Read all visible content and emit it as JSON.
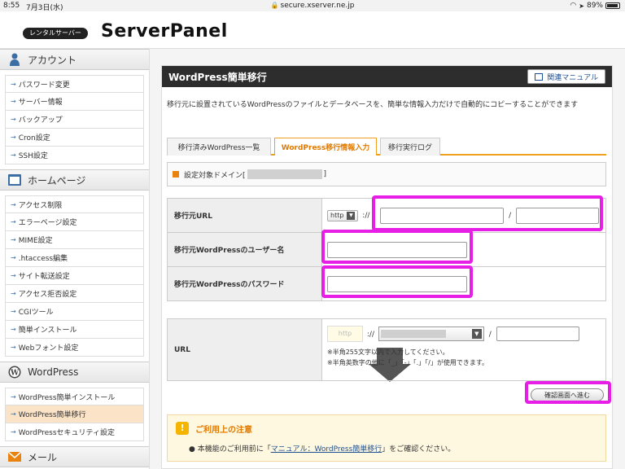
{
  "status_bar": {
    "time": "8:55",
    "date": "7月3日(水)",
    "url": "secure.xserver.ne.jp",
    "battery": "89%"
  },
  "header": {
    "badge": "レンタルサーバー",
    "title": "ServerPanel"
  },
  "sidebar": {
    "sections": [
      {
        "title": "アカウント",
        "icon": "person-icon",
        "items": [
          "パスワード変更",
          "サーバー情報",
          "バックアップ",
          "Cron設定",
          "SSH設定"
        ]
      },
      {
        "title": "ホームページ",
        "icon": "homepage-icon",
        "items": [
          "アクセス制限",
          "エラーページ設定",
          "MIME設定",
          ".htaccess編集",
          "サイト転送設定",
          "アクセス拒否設定",
          "CGIツール",
          "簡単インストール",
          "Webフォント設定"
        ]
      },
      {
        "title": "WordPress",
        "icon": "wordpress-icon",
        "items": [
          "WordPress簡単インストール",
          "WordPress簡単移行",
          "WordPressセキュリティ設定"
        ],
        "active_index": 1
      },
      {
        "title": "メール",
        "icon": "mail-icon",
        "items": []
      }
    ]
  },
  "main": {
    "title": "WordPress簡単移行",
    "manual_button": "関連マニュアル",
    "description": "移行元に設置されているWordPressのファイルとデータベースを、簡単な情報入力だけで自動的にコピーすることができます",
    "tabs": [
      "移行済みWordPress一覧",
      "WordPress移行情報入力",
      "移行実行ログ"
    ],
    "active_tab": 1,
    "domain_label_prefix": "設定対象ドメイン[",
    "domain_label_suffix": "]",
    "form": {
      "source_url_label": "移行元URL",
      "protocol_value": "http",
      "separator_scheme": "://",
      "separator_path": "/",
      "username_label": "移行元WordPressのユーザー名",
      "password_label": "移行元WordPressのパスワード"
    },
    "dest": {
      "url_label": "URL",
      "protocol_placeholder": "http",
      "separator_scheme": "://",
      "separator_path": "/",
      "note1": "※半角255文字以内で入力してください。",
      "note2": "※半角英数字の他に「_」「-」「.」「/」が使用できます。"
    },
    "confirm_button": "確認画面へ進む",
    "notice": {
      "title": "ご利用上の注意",
      "body_prefix": "● 本機能のご利用前に「",
      "link": "マニュアル：WordPress簡単移行",
      "body_suffix": "」をご確認ください。"
    }
  },
  "colors": {
    "highlight": "#e61ee6",
    "accent": "#f0a020",
    "titlebar": "#2d2d2d"
  }
}
